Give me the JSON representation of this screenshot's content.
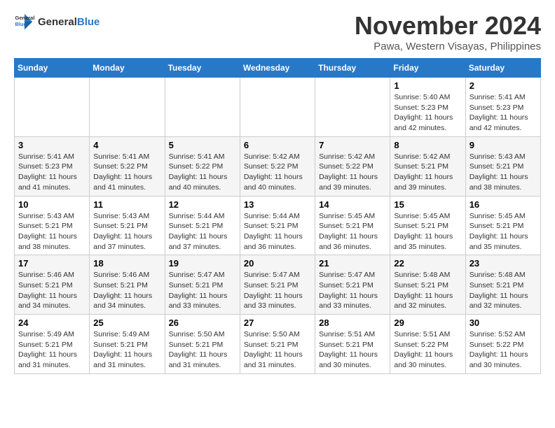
{
  "logo": {
    "general": "General",
    "blue": "Blue"
  },
  "title": "November 2024",
  "subtitle": "Pawa, Western Visayas, Philippines",
  "days_of_week": [
    "Sunday",
    "Monday",
    "Tuesday",
    "Wednesday",
    "Thursday",
    "Friday",
    "Saturday"
  ],
  "weeks": [
    [
      {
        "day": "",
        "info": ""
      },
      {
        "day": "",
        "info": ""
      },
      {
        "day": "",
        "info": ""
      },
      {
        "day": "",
        "info": ""
      },
      {
        "day": "",
        "info": ""
      },
      {
        "day": "1",
        "info": "Sunrise: 5:40 AM\nSunset: 5:23 PM\nDaylight: 11 hours and 42 minutes."
      },
      {
        "day": "2",
        "info": "Sunrise: 5:41 AM\nSunset: 5:23 PM\nDaylight: 11 hours and 42 minutes."
      }
    ],
    [
      {
        "day": "3",
        "info": "Sunrise: 5:41 AM\nSunset: 5:23 PM\nDaylight: 11 hours and 41 minutes."
      },
      {
        "day": "4",
        "info": "Sunrise: 5:41 AM\nSunset: 5:22 PM\nDaylight: 11 hours and 41 minutes."
      },
      {
        "day": "5",
        "info": "Sunrise: 5:41 AM\nSunset: 5:22 PM\nDaylight: 11 hours and 40 minutes."
      },
      {
        "day": "6",
        "info": "Sunrise: 5:42 AM\nSunset: 5:22 PM\nDaylight: 11 hours and 40 minutes."
      },
      {
        "day": "7",
        "info": "Sunrise: 5:42 AM\nSunset: 5:22 PM\nDaylight: 11 hours and 39 minutes."
      },
      {
        "day": "8",
        "info": "Sunrise: 5:42 AM\nSunset: 5:21 PM\nDaylight: 11 hours and 39 minutes."
      },
      {
        "day": "9",
        "info": "Sunrise: 5:43 AM\nSunset: 5:21 PM\nDaylight: 11 hours and 38 minutes."
      }
    ],
    [
      {
        "day": "10",
        "info": "Sunrise: 5:43 AM\nSunset: 5:21 PM\nDaylight: 11 hours and 38 minutes."
      },
      {
        "day": "11",
        "info": "Sunrise: 5:43 AM\nSunset: 5:21 PM\nDaylight: 11 hours and 37 minutes."
      },
      {
        "day": "12",
        "info": "Sunrise: 5:44 AM\nSunset: 5:21 PM\nDaylight: 11 hours and 37 minutes."
      },
      {
        "day": "13",
        "info": "Sunrise: 5:44 AM\nSunset: 5:21 PM\nDaylight: 11 hours and 36 minutes."
      },
      {
        "day": "14",
        "info": "Sunrise: 5:45 AM\nSunset: 5:21 PM\nDaylight: 11 hours and 36 minutes."
      },
      {
        "day": "15",
        "info": "Sunrise: 5:45 AM\nSunset: 5:21 PM\nDaylight: 11 hours and 35 minutes."
      },
      {
        "day": "16",
        "info": "Sunrise: 5:45 AM\nSunset: 5:21 PM\nDaylight: 11 hours and 35 minutes."
      }
    ],
    [
      {
        "day": "17",
        "info": "Sunrise: 5:46 AM\nSunset: 5:21 PM\nDaylight: 11 hours and 34 minutes."
      },
      {
        "day": "18",
        "info": "Sunrise: 5:46 AM\nSunset: 5:21 PM\nDaylight: 11 hours and 34 minutes."
      },
      {
        "day": "19",
        "info": "Sunrise: 5:47 AM\nSunset: 5:21 PM\nDaylight: 11 hours and 33 minutes."
      },
      {
        "day": "20",
        "info": "Sunrise: 5:47 AM\nSunset: 5:21 PM\nDaylight: 11 hours and 33 minutes."
      },
      {
        "day": "21",
        "info": "Sunrise: 5:47 AM\nSunset: 5:21 PM\nDaylight: 11 hours and 33 minutes."
      },
      {
        "day": "22",
        "info": "Sunrise: 5:48 AM\nSunset: 5:21 PM\nDaylight: 11 hours and 32 minutes."
      },
      {
        "day": "23",
        "info": "Sunrise: 5:48 AM\nSunset: 5:21 PM\nDaylight: 11 hours and 32 minutes."
      }
    ],
    [
      {
        "day": "24",
        "info": "Sunrise: 5:49 AM\nSunset: 5:21 PM\nDaylight: 11 hours and 31 minutes."
      },
      {
        "day": "25",
        "info": "Sunrise: 5:49 AM\nSunset: 5:21 PM\nDaylight: 11 hours and 31 minutes."
      },
      {
        "day": "26",
        "info": "Sunrise: 5:50 AM\nSunset: 5:21 PM\nDaylight: 11 hours and 31 minutes."
      },
      {
        "day": "27",
        "info": "Sunrise: 5:50 AM\nSunset: 5:21 PM\nDaylight: 11 hours and 31 minutes."
      },
      {
        "day": "28",
        "info": "Sunrise: 5:51 AM\nSunset: 5:21 PM\nDaylight: 11 hours and 30 minutes."
      },
      {
        "day": "29",
        "info": "Sunrise: 5:51 AM\nSunset: 5:22 PM\nDaylight: 11 hours and 30 minutes."
      },
      {
        "day": "30",
        "info": "Sunrise: 5:52 AM\nSunset: 5:22 PM\nDaylight: 11 hours and 30 minutes."
      }
    ]
  ]
}
